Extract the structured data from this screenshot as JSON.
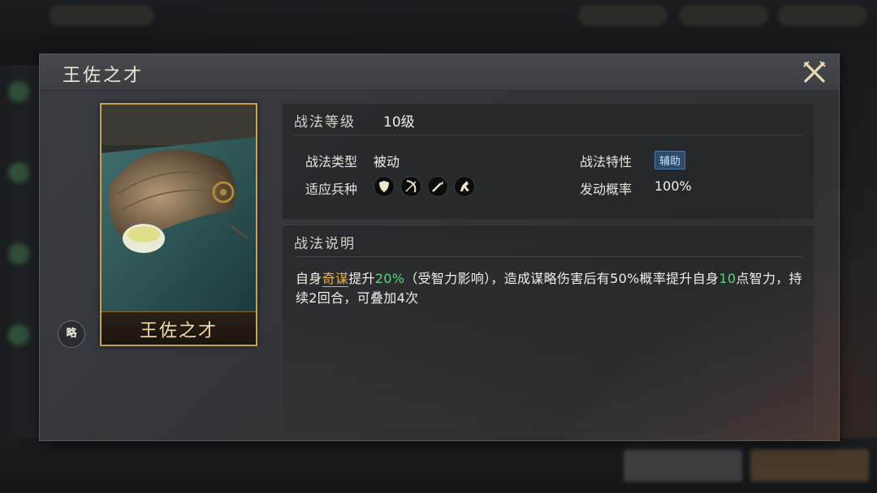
{
  "dialog": {
    "title": "王佐之才"
  },
  "card": {
    "name": "王佐之才"
  },
  "badge": {
    "label": "略"
  },
  "info": {
    "level_label": "战法等级",
    "level_value": "10级",
    "type_label": "战法类型",
    "type_value": "被动",
    "trait_label": "战法特性",
    "trait_value": "辅助",
    "units_label": "适应兵种",
    "units": [
      "shield-icon",
      "bow-icon",
      "spear-icon",
      "horse-icon"
    ],
    "rate_label": "发动概率",
    "rate_value": "100%"
  },
  "description": {
    "title": "战法说明",
    "p1": "自身",
    "p2": "奇谋",
    "p3": "提升",
    "p4": "20%",
    "p5": "（受智力影响），造成谋略伤害后有50%概率提升自身",
    "p6": "10",
    "p7": "点智力，持续2回合，可叠加4次"
  },
  "colors": {
    "card_border": "#c9a24a",
    "highlight_gold": "#e2b04a",
    "highlight_green": "#5fd17c",
    "trait_tag": "#2e4a68"
  }
}
